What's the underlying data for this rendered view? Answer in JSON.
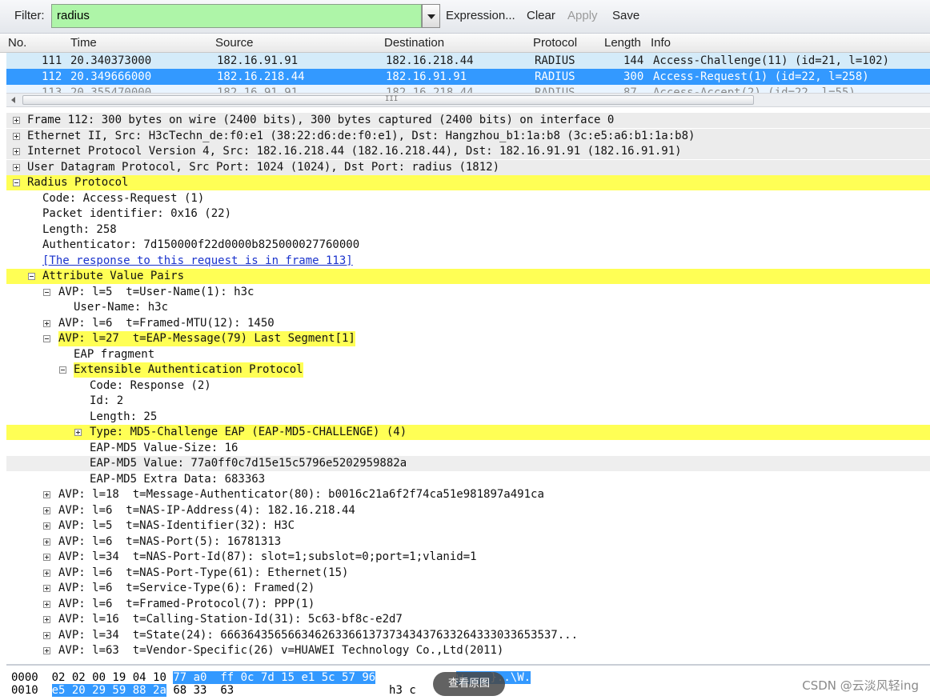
{
  "toolbar": {
    "filter_label": "Filter:",
    "filter_value": "radius",
    "expression_label": "Expression...",
    "clear_label": "Clear",
    "apply_label": "Apply",
    "save_label": "Save"
  },
  "packet_list": {
    "columns": [
      "No.",
      "Time",
      "Source",
      "Destination",
      "Protocol",
      "Length",
      "Info"
    ],
    "rows": [
      {
        "no": "111",
        "time": "20.340373000",
        "source": "182.16.91.91",
        "destination": "182.16.218.44",
        "protocol": "RADIUS",
        "length": "144",
        "info": "Access-Challenge(11) (id=21, l=102)"
      },
      {
        "no": "112",
        "time": "20.349666000",
        "source": "182.16.218.44",
        "destination": "182.16.91.91",
        "protocol": "RADIUS",
        "length": "300",
        "info": "Access-Request(1) (id=22, l=258)"
      },
      {
        "no": "113",
        "time": "20.355470000",
        "source": "182.16.91.91",
        "destination": "182.16.218.44",
        "protocol": "RADIUS",
        "length": "87",
        "info": "Access-Accept(2) (id=22, l=55)"
      }
    ],
    "scrollbar_grip": "III"
  },
  "details": {
    "frame": "Frame 112: 300 bytes on wire (2400 bits), 300 bytes captured (2400 bits) on interface 0",
    "ethernet": "Ethernet II, Src: H3cTechn_de:f0:e1 (38:22:d6:de:f0:e1), Dst: Hangzhou_b1:1a:b8 (3c:e5:a6:b1:1a:b8)",
    "ip": "Internet Protocol Version 4, Src: 182.16.218.44 (182.16.218.44), Dst: 182.16.91.91 (182.16.91.91)",
    "udp": "User Datagram Protocol, Src Port: 1024 (1024), Dst Port: radius (1812)",
    "radius": "Radius Protocol",
    "code": "Code: Access-Request (1)",
    "packet_id": "Packet identifier: 0x16 (22)",
    "length": "Length: 258",
    "authenticator": "Authenticator: 7d150000f22d0000b825000027760000",
    "response_link": "[The response to this request is in frame 113]",
    "avp_group": "Attribute Value Pairs",
    "avp_username": "AVP: l=5  t=User-Name(1): h3c",
    "username_value": "User-Name: h3c",
    "avp_mtu": "AVP: l=6  t=Framed-MTU(12): 1450",
    "avp_eap": "AVP: l=27  t=EAP-Message(79) Last Segment[1]",
    "eap_fragment": "EAP fragment",
    "eap_protocol": "Extensible Authentication Protocol",
    "eap_code": "Code: Response (2)",
    "eap_id": "Id: 2",
    "eap_length": "Length: 25",
    "eap_type": "Type: MD5-Challenge EAP (EAP-MD5-CHALLENGE) (4)",
    "md5_size": "EAP-MD5 Value-Size: 16",
    "md5_value": "EAP-MD5 Value: 77a0ff0c7d15e15c5796e5202959882a",
    "md5_extra": "EAP-MD5 Extra Data: 683363",
    "avp_msg_auth": "AVP: l=18  t=Message-Authenticator(80): b0016c21a6f2f74ca51e981897a491ca",
    "avp_nas_ip": "AVP: l=6  t=NAS-IP-Address(4): 182.16.218.44",
    "avp_nas_id": "AVP: l=5  t=NAS-Identifier(32): H3C",
    "avp_nas_port": "AVP: l=6  t=NAS-Port(5): 16781313",
    "avp_nas_port_id": "AVP: l=34  t=NAS-Port-Id(87): slot=1;subslot=0;port=1;vlanid=1",
    "avp_nas_port_type": "AVP: l=6  t=NAS-Port-Type(61): Ethernet(15)",
    "avp_service_type": "AVP: l=6  t=Service-Type(6): Framed(2)",
    "avp_framed_proto": "AVP: l=6  t=Framed-Protocol(7): PPP(1)",
    "avp_calling_station": "AVP: l=16  t=Calling-Station-Id(31): 5c63-bf8c-e2d7",
    "avp_state": "AVP: l=34  t=State(24): 66636435656634626336613737343437633264333033653537...",
    "avp_vendor": "AVP: l=63  t=Vendor-Specific(26) v=HUAWEI Technology Co.,Ltd(2011)"
  },
  "hex": {
    "line1_offset": "0000",
    "line1_plain": "02 02 00 19 04 10",
    "line1_sel": "77 a0  ff 0c 7d 15 e1 5c 57 96",
    "line1_ascii": "w. ..}..\\W.",
    "line2_offset": "0010",
    "line2_sel": "e5 20 29 59 88 2a",
    "line2_plain": "68 33  63",
    "line2_ascii": "h3 c"
  },
  "overlay": {
    "view_image_label": "查看原图",
    "watermark": "CSDN @云淡风轻ing"
  },
  "colors": {
    "filter_bg": "#aef5a8",
    "selected_row": "#3399ff",
    "highlight": "#ffff55",
    "link": "#1a33cc"
  }
}
